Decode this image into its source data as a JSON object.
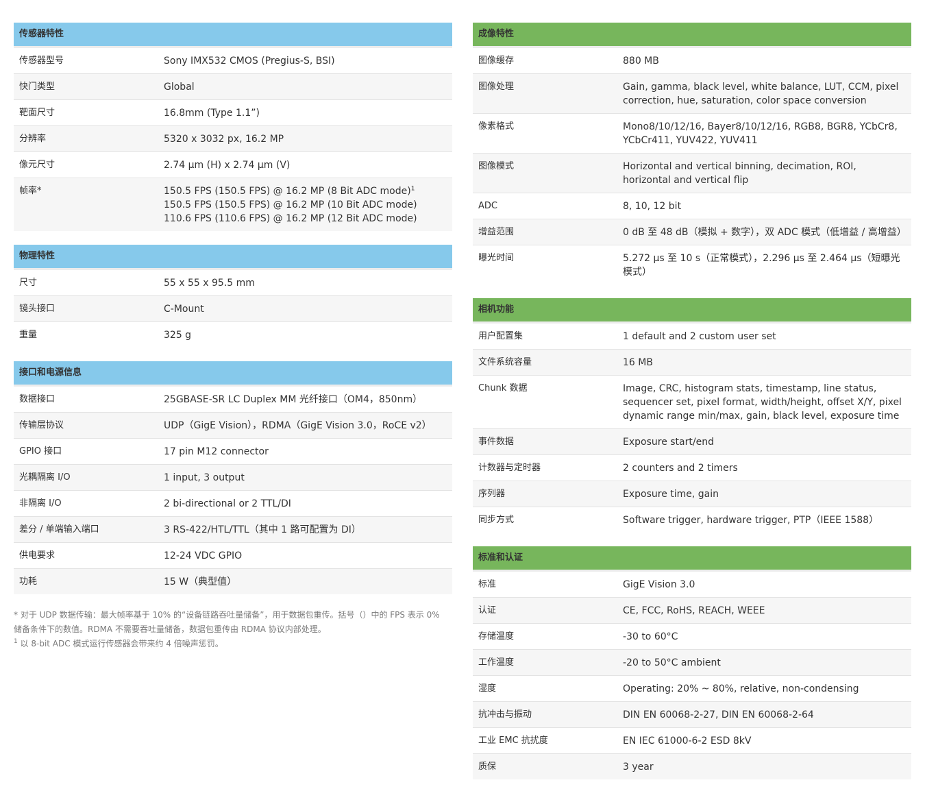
{
  "left": {
    "sections": [
      {
        "title": "传感器特性",
        "rows": [
          {
            "label": "传感器型号",
            "value": "Sony IMX532 CMOS (Pregius-S, BSI)"
          },
          {
            "label": "快门类型",
            "value": "Global"
          },
          {
            "label": "靶面尺寸",
            "value": "16.8mm (Type 1.1”)"
          },
          {
            "label": "分辨率",
            "value": "5320 x 3032 px, 16.2 MP"
          },
          {
            "label": "像元尺寸",
            "value": "2.74 µm (H) x 2.74 µm (V)"
          }
        ],
        "framerate": {
          "label": "帧率*",
          "line1": "150.5 FPS (150.5 FPS) @ 16.2 MP (8 Bit ADC mode)",
          "line1_sup": "1",
          "line2": "150.5 FPS (150.5 FPS) @ 16.2 MP (10 Bit ADC mode)",
          "line3": "110.6 FPS (110.6 FPS) @ 16.2 MP (12 Bit ADC mode)"
        }
      },
      {
        "title": "物理特性",
        "rows": [
          {
            "label": "尺寸",
            "value": "55 x 55 x 95.5 mm"
          },
          {
            "label": "镜头接口",
            "value": "C-Mount"
          },
          {
            "label": "重量",
            "value": "325 g"
          }
        ]
      },
      {
        "title": "接口和电源信息",
        "rows": [
          {
            "label": "数据接口",
            "value": "25GBASE-SR LC Duplex MM 光纤接口（OM4，850nm）"
          },
          {
            "label": "传输层协议",
            "value": "UDP（GigE Vision），RDMA（GigE Vision 3.0，RoCE v2）"
          },
          {
            "label": "GPIO 接口",
            "value": "17 pin M12 connector"
          },
          {
            "label": "光耦隔离 I/O",
            "value": "1 input, 3 output"
          },
          {
            "label": "非隔离 I/O",
            "value": "2 bi-directional or 2 TTL/DI"
          },
          {
            "label": "差分 / 单端输入端口",
            "value": "3 RS-422/HTL/TTL（其中 1 路可配置为 DI）"
          },
          {
            "label": "供电要求",
            "value": "12-24 VDC GPIO"
          },
          {
            "label": "功耗",
            "value": "15 W（典型值）"
          }
        ]
      }
    ],
    "notes": {
      "note1": "* 对于 UDP 数据传输：最大帧率基于 10% 的“设备链路吞吐量储备”，用于数据包重传。括号（）中的 FPS 表示 0% 储备条件下的数值。RDMA 不需要吞吐量储备，数据包重传由 RDMA 协议内部处理。",
      "note2_sup": "1",
      "note2": " 以 8-bit ADC 模式运行传感器会带来约 4 倍噪声惩罚。"
    }
  },
  "right": {
    "sections": [
      {
        "title": "成像特性",
        "rows": [
          {
            "label": "图像缓存",
            "value": "880 MB"
          },
          {
            "label": "图像处理",
            "value": "Gain, gamma, black level, white balance, LUT, CCM, pixel correction, hue, saturation, color space conversion"
          },
          {
            "label": "像素格式",
            "value": "Mono8/10/12/16, Bayer8/10/12/16, RGB8, BGR8, YCbCr8, YCbCr411, YUV422, YUV411"
          },
          {
            "label": "图像模式",
            "value": "Horizontal and vertical binning, decimation, ROI, horizontal and vertical flip"
          },
          {
            "label": "ADC",
            "value": "8, 10, 12 bit"
          },
          {
            "label": "增益范围",
            "value": "0 dB 至 48 dB（模拟 + 数字），双 ADC 模式（低增益 / 高增益）"
          },
          {
            "label": "曝光时间",
            "value": "5.272 µs 至 10 s（正常模式），2.296 µs 至 2.464 µs（短曝光模式）"
          }
        ]
      },
      {
        "title": "相机功能",
        "rows": [
          {
            "label": "用户配置集",
            "value": "1 default and 2 custom user set"
          },
          {
            "label": "文件系统容量",
            "value": "16 MB"
          },
          {
            "label": "Chunk 数据",
            "value": "Image, CRC, histogram stats, timestamp, line status, sequencer set, pixel format, width/height, offset X/Y, pixel dynamic range min/max, gain, black level, exposure time"
          },
          {
            "label": "事件数据",
            "value": "Exposure start/end"
          },
          {
            "label": "计数器与定时器",
            "value": "2 counters and 2 timers"
          },
          {
            "label": "序列器",
            "value": "Exposure time, gain"
          },
          {
            "label": "同步方式",
            "value": "Software trigger, hardware trigger, PTP（IEEE 1588）"
          }
        ]
      },
      {
        "title": "标准和认证",
        "rows": [
          {
            "label": "标准",
            "value": "GigE Vision 3.0"
          },
          {
            "label": "认证",
            "value": "CE, FCC, RoHS, REACH, WEEE"
          },
          {
            "label": "存储温度",
            "value": "-30 to 60°C"
          },
          {
            "label": "工作温度",
            "value": "-20 to 50°C ambient"
          },
          {
            "label": "湿度",
            "value": "Operating: 20% ~ 80%, relative, non-condensing"
          },
          {
            "label": "抗冲击与振动",
            "value": "DIN EN 60068-2-27, DIN EN 60068-2-64"
          },
          {
            "label": "工业 EMC 抗扰度",
            "value": "EN IEC 61000-6-2 ESD 8kV"
          },
          {
            "label": "质保",
            "value": "3 year"
          }
        ]
      }
    ]
  }
}
